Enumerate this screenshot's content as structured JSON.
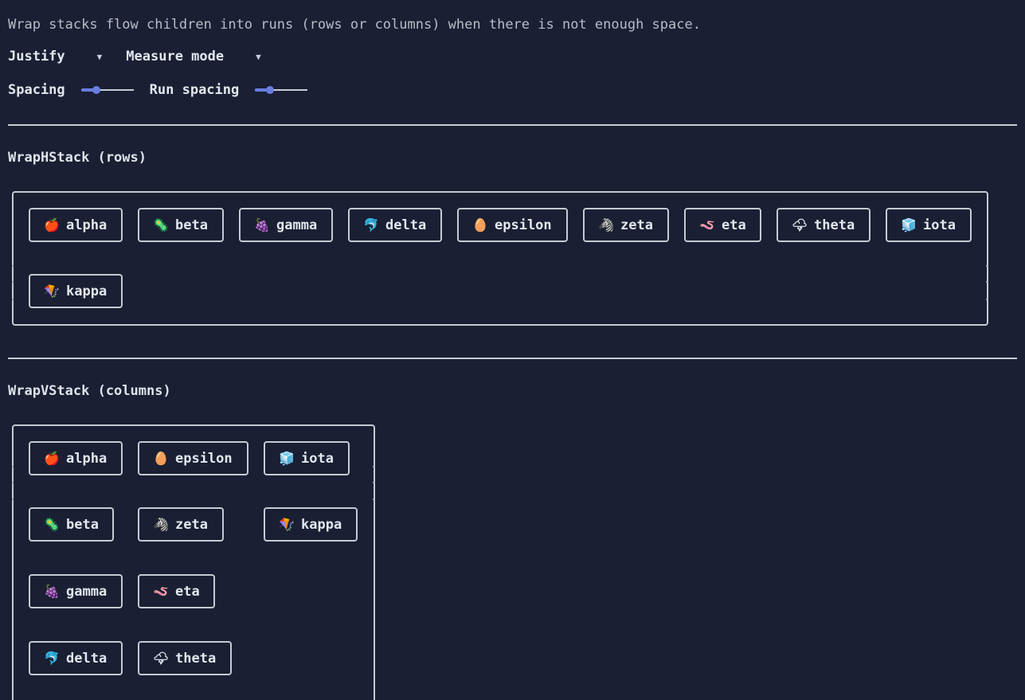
{
  "description": "Wrap stacks flow children into runs (rows or columns) when there is not enough space.",
  "controls": {
    "justify_label": "Justify",
    "measure_label": "Measure mode",
    "spacing_label": "Spacing",
    "run_spacing_label": "Run spacing",
    "spacing_value": 0.25,
    "run_spacing_value": 0.25,
    "accent_color": "#6a7de0"
  },
  "hstack": {
    "title": "WrapHStack (rows)"
  },
  "vstack": {
    "title": "WrapVStack (columns)"
  },
  "items": [
    {
      "label": "alpha",
      "icon": "🍎",
      "icon_name": "apple-icon"
    },
    {
      "label": "beta",
      "icon": "🦠",
      "icon_name": "microbe-icon"
    },
    {
      "label": "gamma",
      "icon": "🍇",
      "icon_name": "grapes-icon"
    },
    {
      "label": "delta",
      "icon": "🐬",
      "icon_name": "dolphin-icon"
    },
    {
      "label": "epsilon",
      "icon": "🥚",
      "icon_name": "egg-icon"
    },
    {
      "label": "zeta",
      "icon": "🦓",
      "icon_name": "zebra-icon"
    },
    {
      "label": "eta",
      "icon": "🪱",
      "icon_name": "worm-icon"
    },
    {
      "label": "theta",
      "icon": "🌩",
      "icon_name": "storm-cloud-icon"
    },
    {
      "label": "iota",
      "icon": "🧊",
      "icon_name": "ice-cube-icon"
    },
    {
      "label": "kappa",
      "icon": "🪁",
      "icon_name": "kite-icon"
    }
  ]
}
